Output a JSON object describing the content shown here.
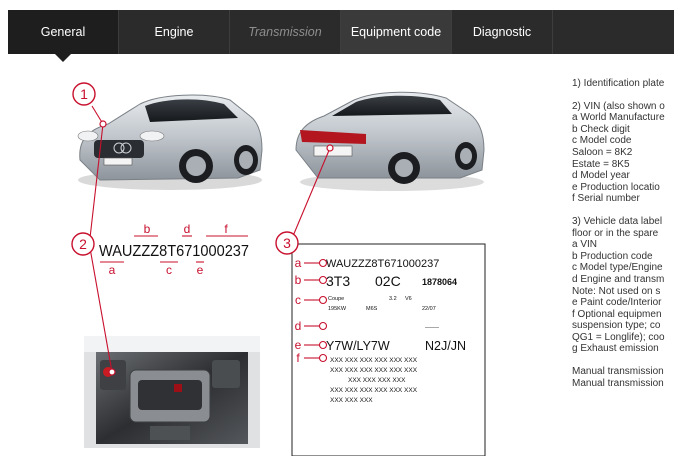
{
  "tabs": [
    {
      "label": "General",
      "state": "active"
    },
    {
      "label": "Engine",
      "state": "normal"
    },
    {
      "label": "Transmission",
      "state": "disabled"
    },
    {
      "label": "Equipment code",
      "state": "highlight"
    },
    {
      "label": "Diagnostic",
      "state": "normal"
    }
  ],
  "colors": {
    "accent": "#c8102e",
    "tabbar": "#2b2b2b",
    "text": "#333333"
  },
  "figure": {
    "callout_numbers": [
      "1",
      "2",
      "3"
    ],
    "vin": {
      "full": "WAUZZZ8T671000237",
      "seg_a": "WAU",
      "seg_b": "ZZZ",
      "seg_c": "8T",
      "seg_d": "6",
      "seg_e": "7",
      "seg_f": "1000237",
      "letters_top": [
        "b",
        "d",
        "f"
      ],
      "letters_bottom": [
        "a",
        "c",
        "e"
      ]
    },
    "label_sheet": {
      "letters": [
        "a",
        "b",
        "c",
        "d",
        "e",
        "f"
      ],
      "vin_line": "WAUZZZ8T671000237",
      "row_b_1": "3T3",
      "row_b_2": "02C",
      "row_b_3": "1878064",
      "row_c1_1": "Coupe",
      "row_c1_2": "3.2",
      "row_c1_3": "V6",
      "row_c2_1": "195KW",
      "row_c2_2": "M6S",
      "row_c2_3": "22/07",
      "row_d_line": "-------",
      "row_e_1": "Y7W/LY7W",
      "row_e_2": "N2J/JN",
      "xxx_1": "XXX XXX XXX XXX XXX XXX",
      "xxx_2": "XXX XXX XXX XXX XXX XXX",
      "xxx_3": "XXX XXX XXX XXX",
      "xxx_4": "XXX XXX XXX XXX XXX XXX",
      "xxx_5": "XXX XXX          XXX"
    }
  },
  "side_text": [
    "1) Identification plate",
    "",
    "2) VIN (also shown o",
    "a World Manufacture",
    "b Check digit",
    "c Model code",
    "Saloon = 8K2",
    "Estate = 8K5",
    "d Model year",
    "e Production locatio",
    "f Serial number",
    "",
    "3) Vehicle data label",
    "floor or in the spare",
    "a VIN",
    "b Production code",
    "c Model type/Engine",
    "d Engine and transm",
    "Note: Not used on s",
    "e Paint code/Interior",
    "f Optional equipmen",
    "suspension type; co",
    "QG1 = Longlife); coo",
    "g Exhaust emission",
    "",
    "Manual transmission",
    "Manual transmission"
  ]
}
